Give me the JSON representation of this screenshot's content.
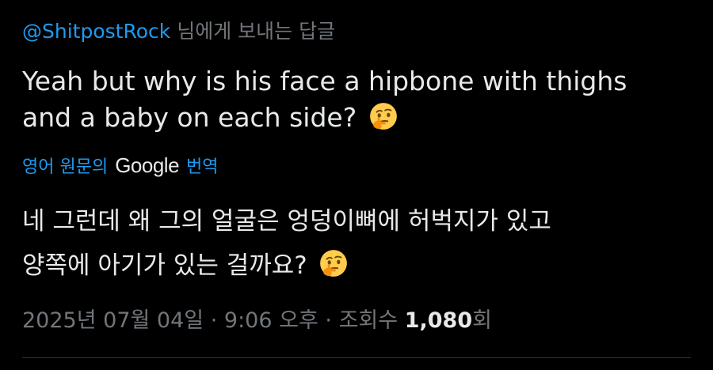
{
  "reply": {
    "handle": "@ShitpostRock",
    "suffix": "님에게 보내는 답글"
  },
  "tweet": {
    "line1": "Yeah but why is his face a hipbone with thighs",
    "line2": "and a baby on each side?",
    "emoji": "thinking-face"
  },
  "translation": {
    "prefix": "영어 원문의",
    "provider": "Google",
    "suffix": "번역",
    "line1": "네 그런데 왜 그의 얼굴은 엉덩이뼈에 허벅지가 있고",
    "line2": "양쪽에 아기가 있는 걸까요?"
  },
  "meta": {
    "date": "2025년 07월 04일",
    "separator1": "·",
    "time": "9:06 오후",
    "separator2": "·",
    "views_label": "조회수",
    "views_count": "1,080",
    "views_unit": "회"
  },
  "colors": {
    "background": "#000000",
    "text": "#e7e9ea",
    "muted": "#71767b",
    "link": "#1d9bf0"
  }
}
